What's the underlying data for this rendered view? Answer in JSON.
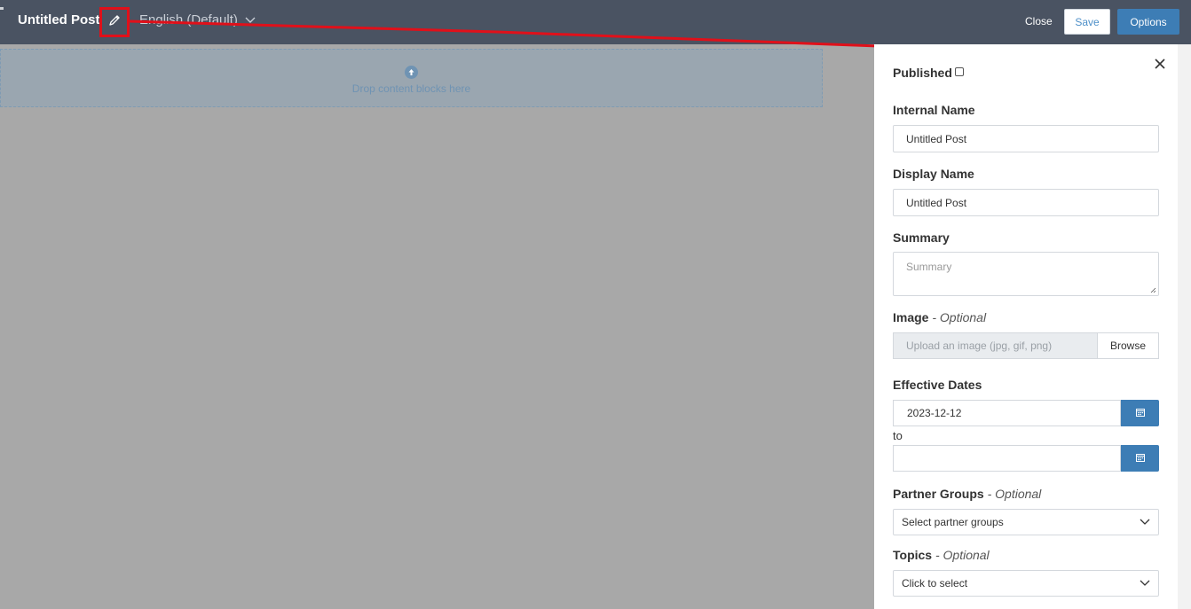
{
  "header": {
    "title": "Untitled Post",
    "language": "English (Default)",
    "close_label": "Close",
    "save_label": "Save",
    "options_label": "Options"
  },
  "canvas": {
    "drop_text": "Drop content blocks here"
  },
  "panel": {
    "published_label": "Published",
    "published_checked": false,
    "internal_name_label": "Internal Name",
    "internal_name_value": "Untitled Post",
    "display_name_label": "Display Name",
    "display_name_value": "Untitled Post",
    "summary_label": "Summary",
    "summary_placeholder": "Summary",
    "image_label": "Image",
    "optional_suffix": "- Optional",
    "image_placeholder": "Upload an image (jpg, gif, png)",
    "browse_label": "Browse",
    "effective_dates_label": "Effective Dates",
    "start_date": "2023-12-12",
    "to_label": "to",
    "end_date": "",
    "partner_groups_label": "Partner Groups",
    "partner_groups_placeholder": "Select partner groups",
    "topics_label": "Topics",
    "topics_placeholder": "Click to select"
  },
  "colors": {
    "topbar": "#4a5362",
    "accent": "#3d7db5",
    "annotation": "#e0101a",
    "canvas_bg": "#a8a8a8"
  },
  "icons": [
    "pencil-icon",
    "chevron-down-icon",
    "arrow-up-circle-icon",
    "close-icon",
    "calendar-icon"
  ]
}
